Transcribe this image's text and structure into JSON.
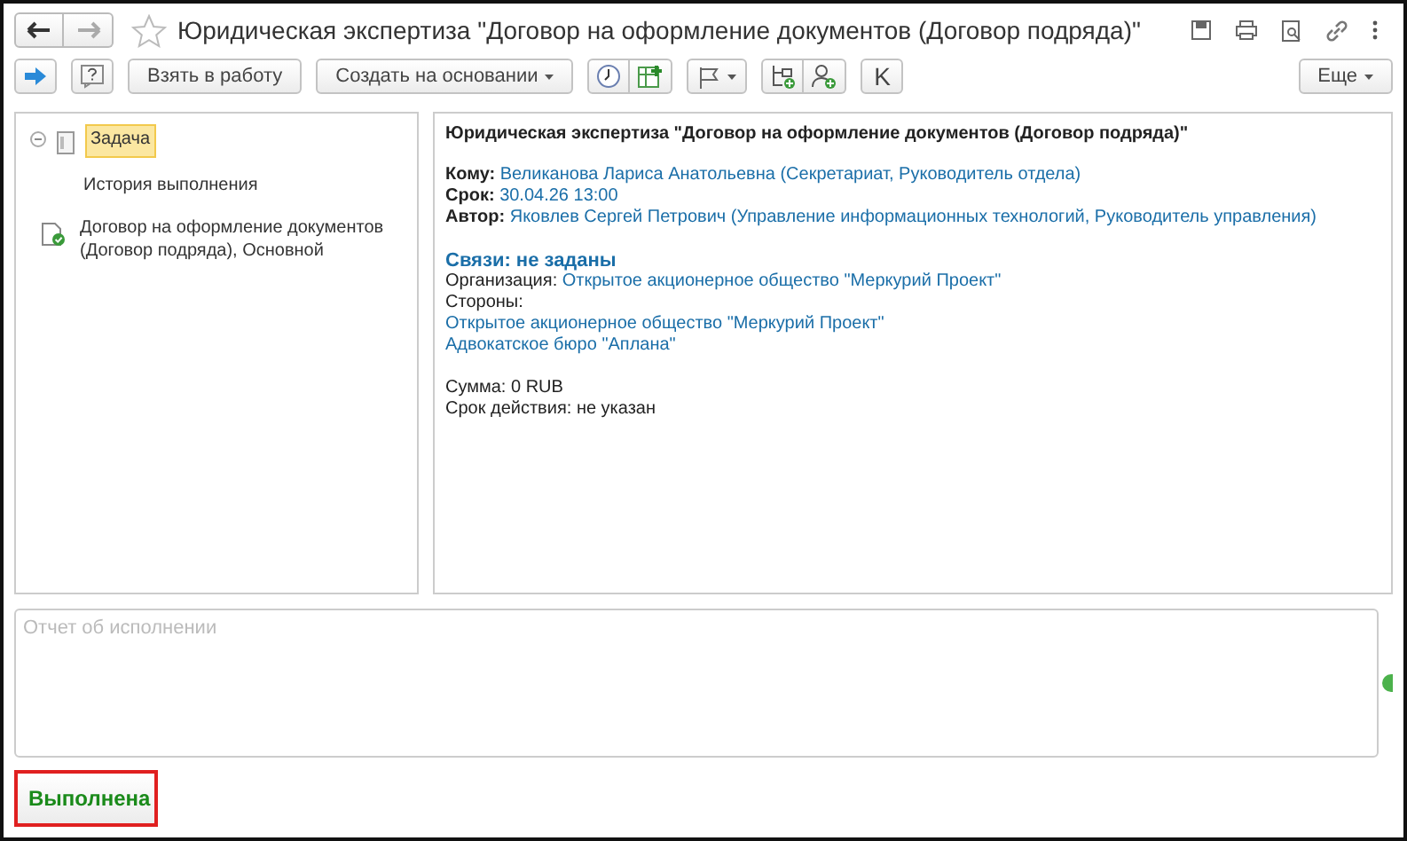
{
  "window": {
    "title": "Юридическая экспертиза \"Договор на оформление документов (Договор подряда)\"",
    "favorite": false
  },
  "toolbar": [
    {
      "kind": "arrow"
    },
    {
      "kind": "help"
    },
    {
      "kind": "button",
      "label": "Взять в работу"
    },
    {
      "kind": "dropdown",
      "label": "Создать на основании"
    },
    {
      "kind": "clock"
    },
    {
      "kind": "table"
    },
    {
      "kind": "flag"
    },
    {
      "kind": "hierarchy"
    },
    {
      "kind": "user"
    },
    {
      "kind": "letter",
      "label": "K"
    }
  ],
  "more": {
    "label": "Еще"
  },
  "tree": [
    {
      "kind": "task",
      "label": "Задача",
      "selected": true,
      "expanded": true
    },
    {
      "kind": "history",
      "label": "История выполнения",
      "selected": false
    },
    {
      "kind": "document",
      "label": "Договор на оформление документов (Договор подряда), Основной",
      "selected": false
    }
  ],
  "details": {
    "title": "Юридическая экспертиза \"Договор на оформление документов (Договор подряда)\"",
    "groups": [
      [
        {
          "label": "Кому:",
          "value": "Великанова Лариса Анатольевна (Секретариат, Руководитель отдела)",
          "label_bold": true,
          "link": true
        },
        {
          "label": "Срок:",
          "value": "30.04.26 13:00",
          "label_bold": true,
          "link": true
        },
        {
          "label": "Автор:",
          "value": "Яковлев Сергей Петрович (Управление информационных технологий, Руководитель управления)",
          "label_bold": true,
          "link": true
        }
      ],
      [
        {
          "kind": "heading",
          "value": "Связи: не заданы"
        },
        {
          "label": "Организация:",
          "value": "Открытое акционерное общество \"Меркурий Проект\"",
          "label_bold": false,
          "link": true
        },
        {
          "label": "Стороны:",
          "label_bold": false
        },
        {
          "value": "Открытое акционерное общество \"Меркурий Проект\"",
          "link": true
        },
        {
          "value": "Адвокатское бюро \"Аплана\"",
          "link": true
        }
      ],
      [
        {
          "label": "Сумма:",
          "value": "0 RUB",
          "label_bold": false,
          "link": false
        },
        {
          "label": "Срок действия:",
          "value": "не указан",
          "label_bold": false,
          "link": false
        }
      ]
    ]
  },
  "report": {
    "placeholder": "Отчет об исполнении"
  },
  "complete_button": {
    "label": "Выполнена"
  }
}
